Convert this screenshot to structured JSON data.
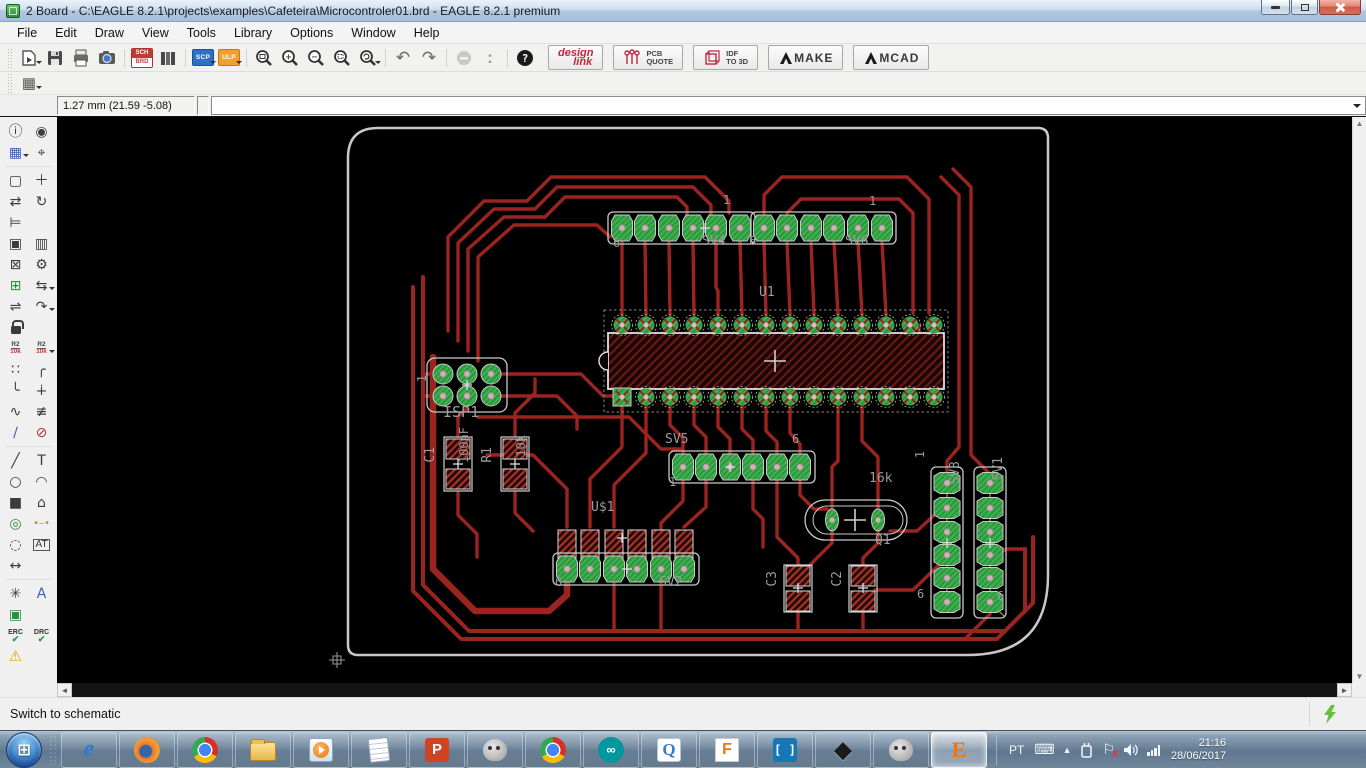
{
  "window": {
    "title": "2 Board - C:\\EAGLE 8.2.1\\projects\\examples\\Cafeteira\\Microcontroler01.brd - EAGLE 8.2.1 premium"
  },
  "menu": {
    "items": [
      "File",
      "Edit",
      "Draw",
      "View",
      "Tools",
      "Library",
      "Options",
      "Window",
      "Help"
    ]
  },
  "toolbar": {
    "badges": {
      "sch": "SCH",
      "brd": "BRD",
      "scp": "SCP",
      "ulp": "ULP"
    },
    "vendor": {
      "design_1": "design",
      "design_2": "link",
      "quote_1": "PCB",
      "quote_2": "QUOTE",
      "idf_1": "IDF",
      "idf_2": "TO 3D",
      "make": "MAKE",
      "mcad": "MCAD"
    }
  },
  "icons": {
    "zoom_in": "+",
    "zoom_out": "−",
    "help": "?",
    "undo": "↶",
    "redo": "↷",
    "more": ":",
    "grid": "▦",
    "keyboard": "⌨",
    "hidden": "▲",
    "flag": "⚐",
    "flag_x": "✗",
    "hscroll_left": "◄",
    "hscroll_right": "►",
    "vscroll_up": "▲",
    "vscroll_down": "▼"
  },
  "command_bar": {
    "coordinate": "1.27 mm (21.59 -5.08)",
    "command_value": ""
  },
  "palette": {
    "tools": [
      {
        "name": "info",
        "glyph": "ⓘ"
      },
      {
        "name": "show",
        "glyph": "◉"
      },
      {
        "name": "display-layers",
        "glyph": "▦"
      },
      {
        "name": "mark",
        "glyph": "⌖"
      },
      {
        "name": "group",
        "glyph": "▢"
      },
      {
        "name": "move",
        "glyph": "＋"
      },
      {
        "name": "mirror",
        "glyph": "⇄"
      },
      {
        "name": "rotate",
        "glyph": "↻"
      },
      {
        "name": "name",
        "glyph": "⊨"
      },
      {
        "name": "copy",
        "glyph": "▣"
      },
      {
        "name": "paste",
        "glyph": "▥"
      },
      {
        "name": "delete",
        "glyph": "⊠"
      },
      {
        "name": "change",
        "glyph": "⚙"
      },
      {
        "name": "add",
        "glyph": "⊞"
      },
      {
        "name": "gateswap",
        "glyph": "⇆"
      },
      {
        "name": "pinswap",
        "glyph": "⇌"
      },
      {
        "name": "replace",
        "glyph": "↷"
      },
      {
        "name": "lock",
        "glyph": ""
      },
      {
        "name": "value",
        "top": "R2",
        "bottom": "10k"
      },
      {
        "name": "smash",
        "top": "R2",
        "bottom": "10k"
      },
      {
        "name": "optimize",
        "glyph": "∷"
      },
      {
        "name": "miter",
        "glyph": "╭"
      },
      {
        "name": "miter2",
        "glyph": "╰"
      },
      {
        "name": "mark-cross",
        "glyph": "∔"
      },
      {
        "name": "meander",
        "glyph": "∿"
      },
      {
        "name": "split",
        "glyph": "≢"
      },
      {
        "name": "route",
        "glyph": "∕"
      },
      {
        "name": "ripup",
        "glyph": "⊘"
      },
      {
        "name": "wire",
        "glyph": "╱"
      },
      {
        "name": "text",
        "glyph": "T"
      },
      {
        "name": "circle",
        "glyph": "○"
      },
      {
        "name": "arc",
        "glyph": "◠"
      },
      {
        "name": "rect",
        "glyph": "■"
      },
      {
        "name": "polygon",
        "glyph": "⌂"
      },
      {
        "name": "via",
        "glyph": "◎"
      },
      {
        "name": "signal",
        "glyph": "•–•"
      },
      {
        "name": "hole",
        "glyph": "◌"
      },
      {
        "name": "attribute",
        "glyph": "AT"
      },
      {
        "name": "dimension",
        "glyph": "↔"
      },
      {
        "name": "ratsnest",
        "glyph": "✳"
      },
      {
        "name": "autoroute",
        "glyph": "A"
      },
      {
        "name": "designrules",
        "glyph": "▣"
      },
      {
        "name": "erc",
        "label": "ERC",
        "check": "✔"
      },
      {
        "name": "drc",
        "label": "DRC",
        "check": "✔"
      },
      {
        "name": "errors",
        "glyph": "⚠"
      }
    ]
  },
  "board": {
    "labels": {
      "sv4": "SV4",
      "sv4_pin1": "1",
      "sv4_pin6": "6",
      "sv6": "SV6",
      "sv6_pin1": "1",
      "sv6_pin6": "6",
      "u1": "U1",
      "isp1": "ISP1",
      "isp1_pin1": "1",
      "c1": "C1",
      "c1_value": "100nF",
      "r1": "R1",
      "r1_value": "10k",
      "sv5": "SV5",
      "sv5_pin1": "1",
      "sv5_pin6": "6",
      "q1": "Q1",
      "q1_value": "16k",
      "usd1": "U$1",
      "sv2": "SV2",
      "sv2_pin6": "6",
      "c2": "C2",
      "c3": "C3",
      "sv3": "SV3",
      "sv3_pin1": "1",
      "sv3_pin6": "6",
      "sv1": "SV1",
      "sv1_pin6": "6"
    }
  },
  "status_bar": {
    "message": "Switch to schematic"
  },
  "taskbar": {
    "apps": [
      "internet-explorer",
      "firefox",
      "chrome",
      "windows-explorer",
      "media-player",
      "notepad",
      "powerpoint",
      "gimp",
      "chrome-2",
      "arduino",
      "quicktime",
      "fusion-360",
      "brackets",
      "inkscape",
      "gimp-2",
      "eagle"
    ],
    "tray": {
      "language": "PT",
      "time": "21:16",
      "date": "28/06/2017"
    }
  }
}
